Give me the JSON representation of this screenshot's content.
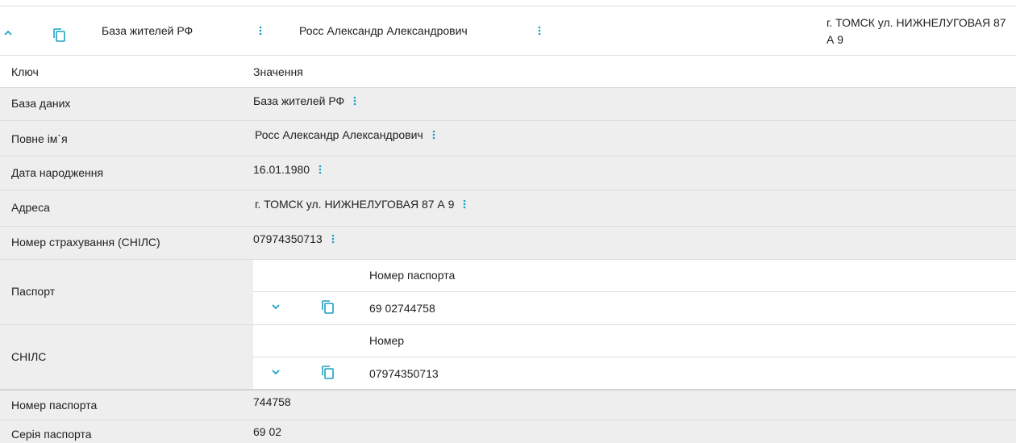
{
  "header": {
    "database": "База жителей РФ",
    "name": "Росс Александр Александрович",
    "address_line1": "г. ТОМСК ул. НИЖНЕЛУГОВАЯ 87",
    "address_line2": "А 9"
  },
  "table": {
    "key_header": "Ключ",
    "value_header": "Значення",
    "rows": [
      {
        "key": "База даних",
        "value": "База жителей РФ"
      },
      {
        "key": "Повне ім`я",
        "value": "Росс Александр Александрович"
      },
      {
        "key": "Дата народження",
        "value": "16.01.1980"
      },
      {
        "key": "Адреса",
        "value": "г. ТОМСК ул. НИЖНЕЛУГОВАЯ 87 А 9"
      },
      {
        "key": "Номер страхування (СНІЛС)",
        "value": "07974350713"
      }
    ],
    "passport": {
      "key": "Паспорт",
      "column": "Номер паспорта",
      "value": "69 02744758"
    },
    "snils": {
      "key": "СНІЛС",
      "column": "Номер",
      "value": "07974350713"
    },
    "tail_rows": [
      {
        "key": "Номер паспорта",
        "value": "744758"
      },
      {
        "key": "Серія паспорта",
        "value": "69 02"
      }
    ]
  },
  "colors": {
    "accent": "#1da1c4",
    "row_gray": "#eeeeee",
    "divider": "#dcdcdc"
  },
  "icons": [
    "chevron-up-icon",
    "copy-icon",
    "more-vert-icon",
    "chevron-down-icon"
  ]
}
